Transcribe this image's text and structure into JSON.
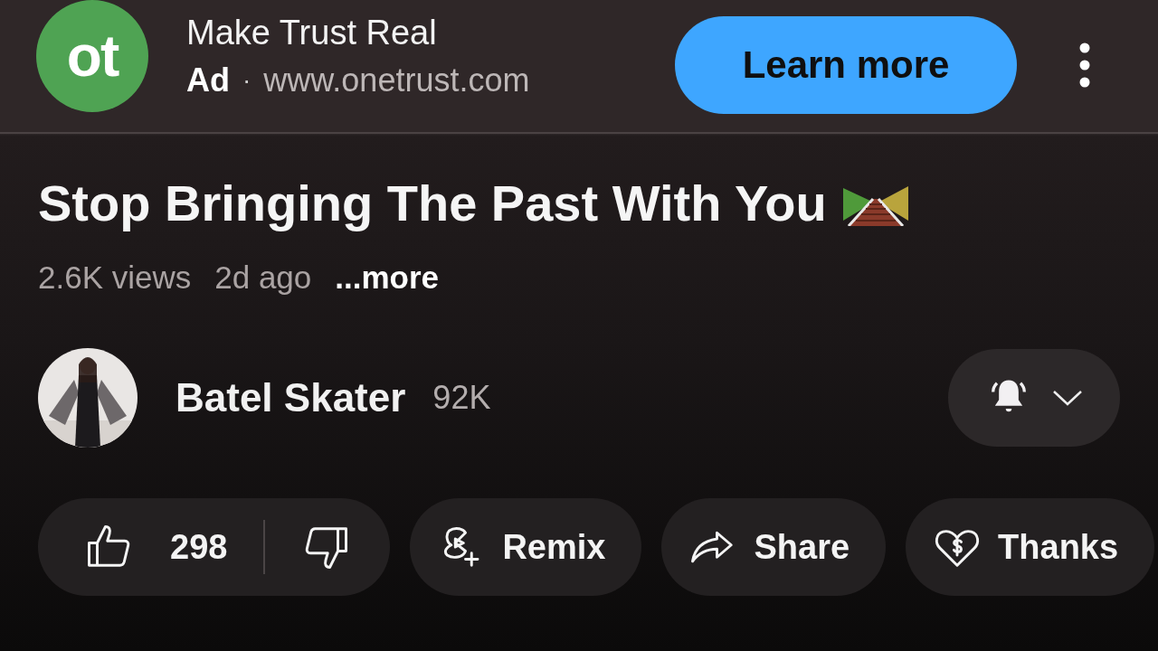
{
  "ad": {
    "logo": "ot",
    "title": "Make Trust Real",
    "label": "Ad",
    "separator": "·",
    "url": "www.onetrust.com",
    "cta": "Learn more"
  },
  "video": {
    "title": "Stop Bringing The Past With You",
    "views": "2.6K views",
    "age": "2d ago",
    "more": "...more"
  },
  "channel": {
    "name": "Batel Skater",
    "subscribers": "92K"
  },
  "actions": [
    {
      "kind": "like",
      "label": "298"
    },
    {
      "kind": "remix",
      "label": "Remix"
    },
    {
      "kind": "share",
      "label": "Share"
    },
    {
      "kind": "thanks",
      "label": "Thanks"
    }
  ]
}
